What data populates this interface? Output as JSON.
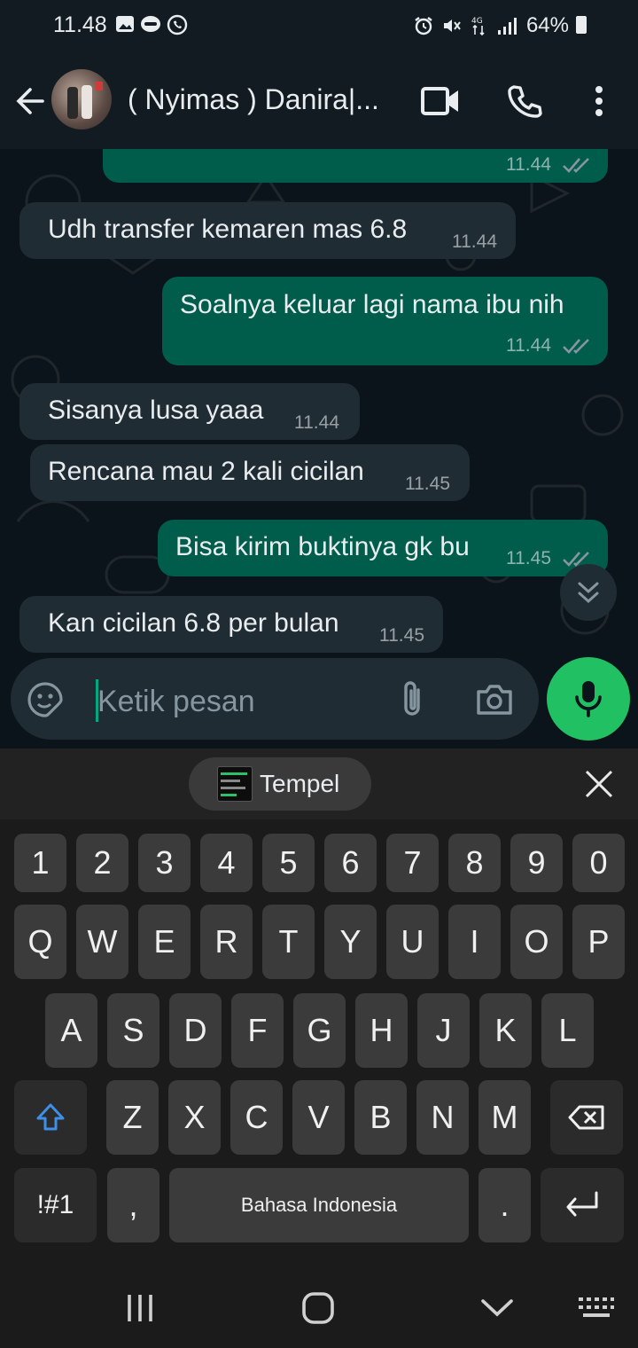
{
  "status_bar": {
    "time": "11.48",
    "battery": "64%",
    "network": "4G"
  },
  "header": {
    "contact_name": "( Nyimas ) Danira|..."
  },
  "messages": [
    {
      "dir": "out",
      "text": "",
      "time": "11.44",
      "read": true
    },
    {
      "dir": "in",
      "text": "Udh transfer kemaren mas 6.8",
      "time": "11.44"
    },
    {
      "dir": "out",
      "text": "Soalnya keluar lagi nama ibu nih",
      "time": "11.44",
      "read": true
    },
    {
      "dir": "in",
      "text": "Sisanya lusa yaaa",
      "time": "11.44"
    },
    {
      "dir": "in",
      "text": "Rencana mau 2 kali cicilan",
      "time": "11.45"
    },
    {
      "dir": "out",
      "text": "Bisa kirim buktinya gk bu",
      "time": "11.45",
      "read": true
    },
    {
      "dir": "in",
      "text": "Kan cicilan 6.8 per bulan",
      "time": "11.45"
    }
  ],
  "composer": {
    "placeholder": "Ketik pesan"
  },
  "keyboard": {
    "paste_label": "Tempel",
    "row_numbers": [
      "1",
      "2",
      "3",
      "4",
      "5",
      "6",
      "7",
      "8",
      "9",
      "0"
    ],
    "row_q": [
      "Q",
      "W",
      "E",
      "R",
      "T",
      "Y",
      "U",
      "I",
      "O",
      "P"
    ],
    "row_a": [
      "A",
      "S",
      "D",
      "F",
      "G",
      "H",
      "J",
      "K",
      "L"
    ],
    "row_z": [
      "Z",
      "X",
      "C",
      "V",
      "B",
      "N",
      "M"
    ],
    "symbols_label": "!#1",
    "comma_label": ",",
    "space_label": "Bahasa Indonesia",
    "period_label": "."
  },
  "colors": {
    "incoming_bubble": "#202c33",
    "outgoing_bubble": "#005c4b",
    "mic_button": "#21c063",
    "background": "#0b141a"
  }
}
